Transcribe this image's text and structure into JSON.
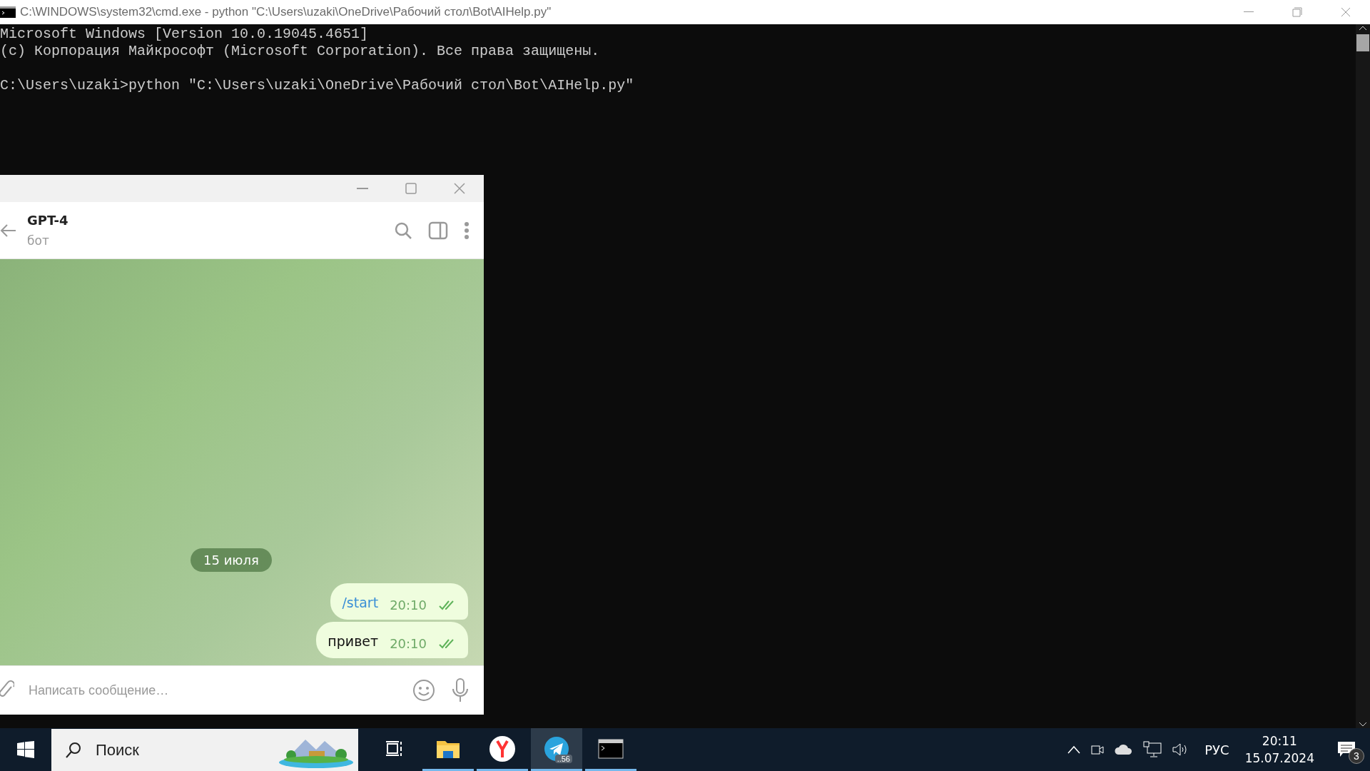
{
  "console": {
    "title": "C:\\WINDOWS\\system32\\cmd.exe - python  \"C:\\Users\\uzaki\\OneDrive\\Рабочий стол\\Bot\\AIHelp.py\"",
    "header_lines": [
      "Microsoft Windows [Version 10.0.19045.4651]",
      "(c) Корпорация Майкрософт (Microsoft Corporation). Все права защищены."
    ],
    "command_line": "C:\\Users\\uzaki>python \"C:\\Users\\uzaki\\OneDrive\\Рабочий стол\\Bot\\AIHelp.py\""
  },
  "telegram": {
    "chat_name": "GPT-4",
    "chat_status": "бот",
    "date": "15 июля",
    "messages": [
      {
        "kind": "command",
        "text": "/start",
        "time": "20:10",
        "read": true
      },
      {
        "kind": "text",
        "text": "привет",
        "time": "20:10",
        "read": true
      }
    ],
    "input": {
      "placeholder": "Написать сообщение…"
    }
  },
  "taskbar": {
    "search": {
      "placeholder": "Поиск"
    },
    "apps": [
      {
        "kind": "taskview",
        "running": false,
        "selected": false
      },
      {
        "kind": "explorer",
        "running": true,
        "selected": false
      },
      {
        "kind": "browser",
        "running": true,
        "selected": false
      },
      {
        "kind": "telegram",
        "running": true,
        "selected": true,
        "badge": "..56"
      },
      {
        "kind": "console",
        "running": true,
        "selected": false
      }
    ],
    "language": "РУС",
    "time": "20:11",
    "date": "15.07.2024",
    "notifications": "3"
  }
}
